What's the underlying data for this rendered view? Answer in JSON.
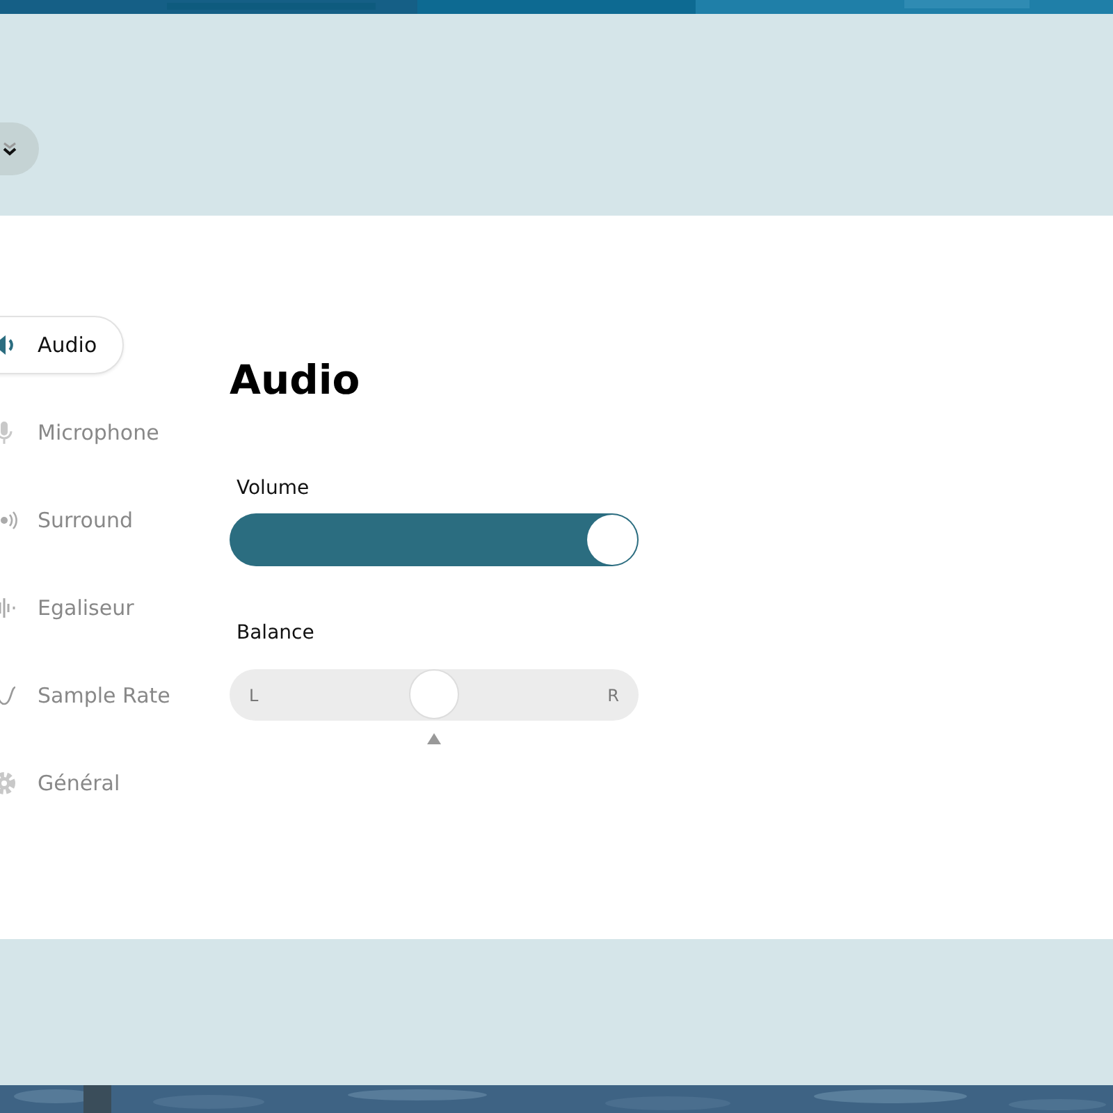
{
  "nav": [
    {
      "label": "Audio",
      "selected": true
    },
    {
      "label": "Microphone",
      "selected": false
    },
    {
      "label": "Surround",
      "selected": false
    },
    {
      "label": "Egaliseur",
      "selected": false
    },
    {
      "label": "Sample Rate",
      "selected": false
    },
    {
      "label": "Général",
      "selected": false
    }
  ],
  "title": "Audio",
  "volume": {
    "label": "Volume",
    "level": 1.0
  },
  "balance": {
    "label": "Balance",
    "left": "L",
    "right": "R",
    "level": 0.5
  }
}
